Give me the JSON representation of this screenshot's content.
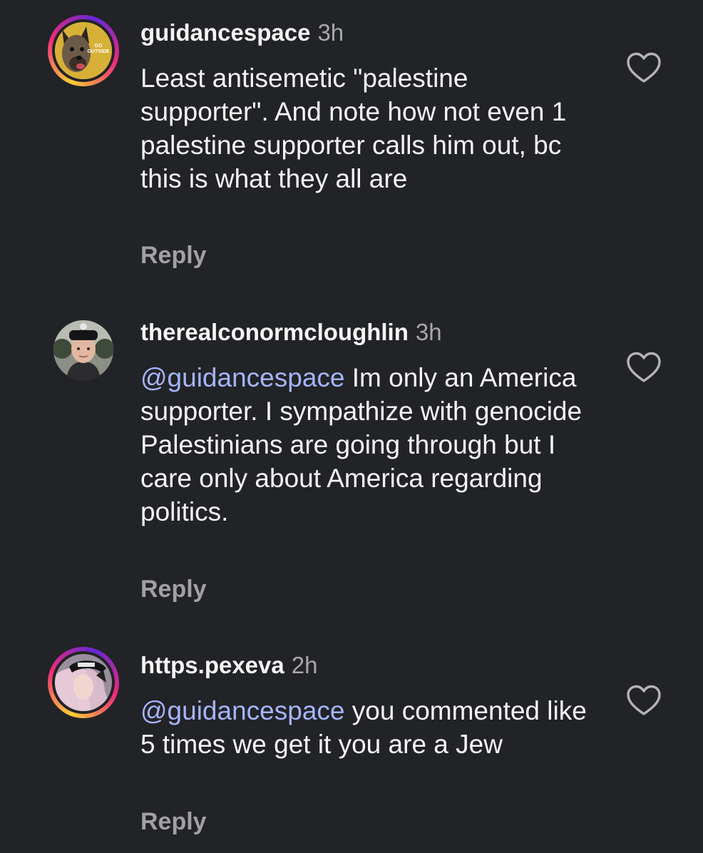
{
  "comments": [
    {
      "username": "guidancespace",
      "time": "3h",
      "mention": "",
      "text": "Least antisemetic \"palestine supporter\". And note how not even 1 palestine supporter calls him out, bc this is what they all are",
      "reply_label": "Reply",
      "avatar_icon": "dog-avatar",
      "avatar_caption": "GO OUTSIDE"
    },
    {
      "username": "therealconormcloughlin",
      "time": "3h",
      "mention": "@guidancespace",
      "text": "Im only an America supporter. I sympathize with genocide Palestinians are going through but I care only about America regarding politics.",
      "reply_label": "Reply",
      "avatar_icon": "person-avatar"
    },
    {
      "username": "https.pexeva",
      "time": "2h",
      "mention": "@guidancespace",
      "text": "you commented like 5 times we get it you are a Jew",
      "reply_label": "Reply",
      "avatar_icon": "person-avatar"
    }
  ],
  "colors": {
    "background": "#222326",
    "mention": "#a5b4fc",
    "secondary_text": "#a8a8a8",
    "story_ring_start": "#f9ce34",
    "story_ring_end": "#ee2a7b"
  },
  "icons": {
    "like": "heart-outline-icon"
  }
}
